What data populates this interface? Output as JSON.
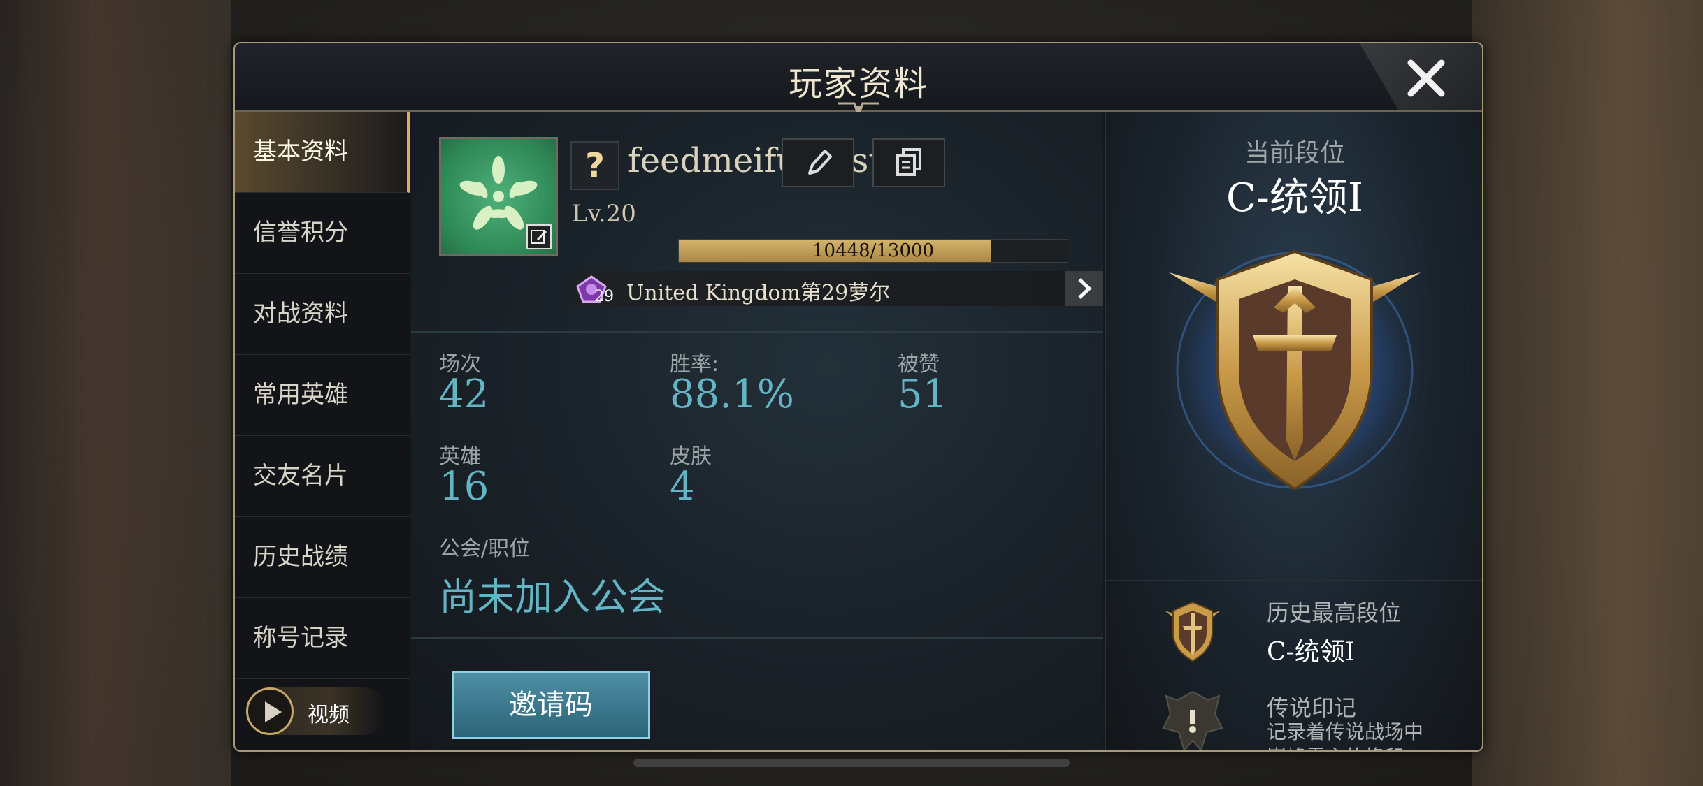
{
  "window": {
    "title": "玩家资料",
    "close_icon": "close-icon"
  },
  "sidebar": {
    "items": [
      {
        "label": "基本资料",
        "active": true
      },
      {
        "label": "信誉积分",
        "active": false
      },
      {
        "label": "对战资料",
        "active": false
      },
      {
        "label": "常用英雄",
        "active": false
      },
      {
        "label": "交友名片",
        "active": false
      },
      {
        "label": "历史战绩",
        "active": false
      },
      {
        "label": "称号记录",
        "active": false
      }
    ],
    "video_label": "视频"
  },
  "profile": {
    "qmark": "?",
    "username": "feedmeifumust",
    "level": "Lv.20",
    "xp_text": "10448/13000",
    "xp_fraction": 0.8037,
    "server_badge_num": "29",
    "server_name": "United Kingdom第29萝尔"
  },
  "stats": {
    "matches_label": "场次",
    "matches": "42",
    "winrate_label": "胜率:",
    "winrate": "88.1%",
    "likes_label": "被赞",
    "likes": "51",
    "heroes_label": "英雄",
    "heroes": "16",
    "skins_label": "皮肤",
    "skins": "4",
    "guild_label": "公会/职位",
    "guild": "尚未加入公会"
  },
  "invite": {
    "label": "邀请码"
  },
  "rank": {
    "current_label": "当前段位",
    "current_value": "C-统领I",
    "history_label": "历史最高段位",
    "history_value": "C-统领I",
    "legend_label": "传说印记",
    "legend_desc_1": "记录着传说战场中",
    "legend_desc_2": "巅峰霸主的烙印"
  },
  "colors": {
    "accent_gold": "#d6b06a",
    "stat_blue": "#63b4c4",
    "invite_blue": "#3a7a90"
  }
}
